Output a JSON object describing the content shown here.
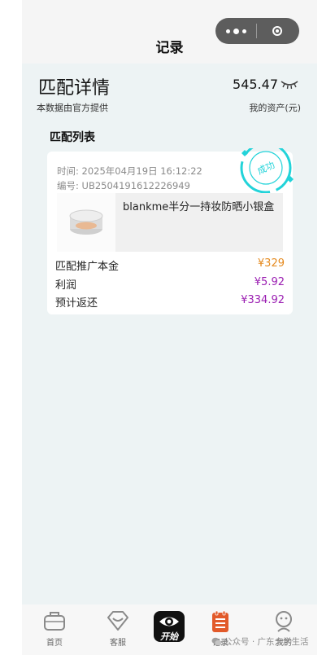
{
  "header": {
    "title": "记录"
  },
  "summary": {
    "heading": "匹配详情",
    "source_note": "本数据由官方提供",
    "total_assets": "545.47",
    "assets_label": "我的资产(元)"
  },
  "list": {
    "title": "匹配列表",
    "items": [
      {
        "time_label": "时间: 2025年04月19日 16:12:22",
        "id_label": "编号: UB2504191612226949",
        "product_name": "blankme半分一持妆防晒小银盒",
        "stamp_text": "成功",
        "rows": [
          {
            "label": "匹配推广本金",
            "value": "¥329"
          },
          {
            "label": "利润",
            "value": "¥5.92"
          },
          {
            "label": "预计返还",
            "value": "¥334.92"
          }
        ]
      }
    ]
  },
  "tabbar": {
    "home": "首页",
    "service": "客服",
    "start": "开始",
    "records": "记录",
    "me": "我的"
  },
  "watermark": "公众号 · 广东大学生活",
  "colors": {
    "accent_cyan": "#22d3d9",
    "orange": "#e58a1f",
    "purple": "#9b1fb2",
    "records_red": "#e25a2a"
  }
}
